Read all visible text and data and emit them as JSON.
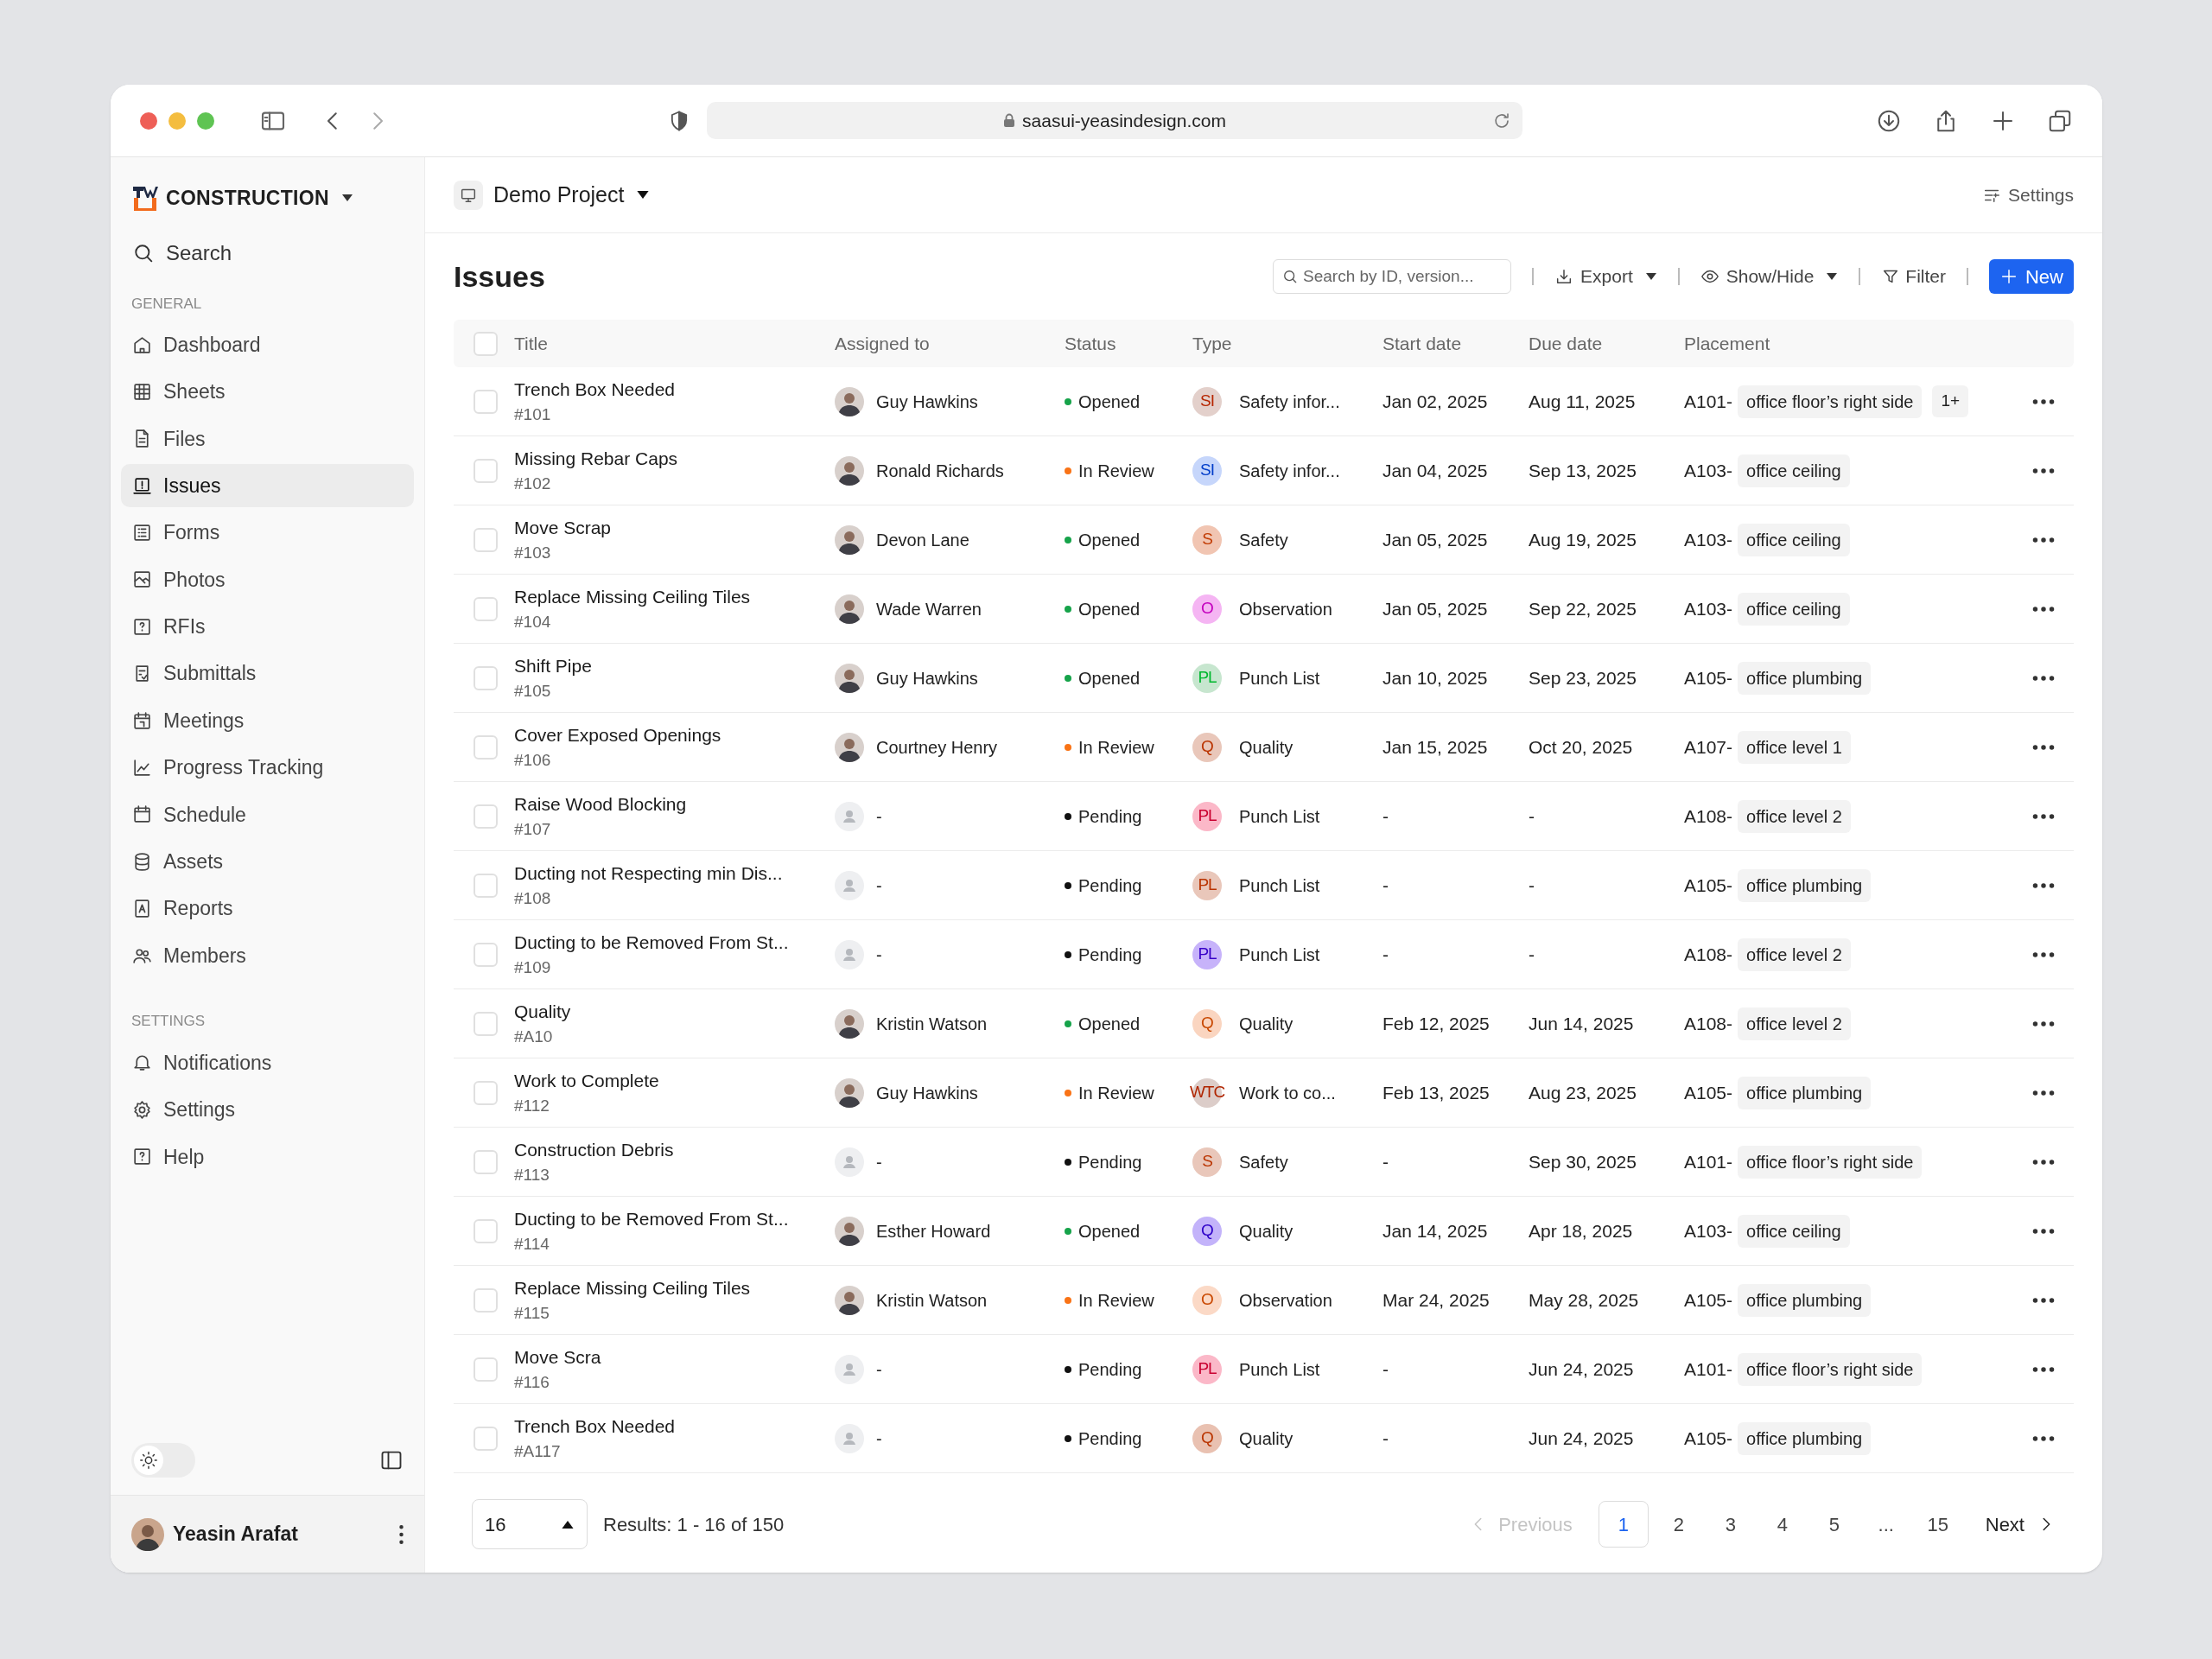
{
  "browser": {
    "url": "saasui-yeasindesign.com"
  },
  "sidebar": {
    "brand": "CONSTRUCTION",
    "search": "Search",
    "sections": [
      {
        "heading": "GENERAL",
        "items": [
          {
            "label": "Dashboard",
            "selected": false
          },
          {
            "label": "Sheets",
            "selected": false
          },
          {
            "label": "Files",
            "selected": false
          },
          {
            "label": "Issues",
            "selected": true
          },
          {
            "label": "Forms",
            "selected": false
          },
          {
            "label": "Photos",
            "selected": false
          },
          {
            "label": "RFIs",
            "selected": false
          },
          {
            "label": "Submittals",
            "selected": false
          },
          {
            "label": "Meetings",
            "selected": false
          },
          {
            "label": "Progress Tracking",
            "selected": false
          },
          {
            "label": "Schedule",
            "selected": false
          },
          {
            "label": "Assets",
            "selected": false
          },
          {
            "label": "Reports",
            "selected": false
          },
          {
            "label": "Members",
            "selected": false
          }
        ]
      },
      {
        "heading": "SETTINGS",
        "items": [
          {
            "label": "Notifications",
            "selected": false
          },
          {
            "label": "Settings",
            "selected": false
          },
          {
            "label": "Help",
            "selected": false
          }
        ]
      }
    ],
    "theme_toggle": {
      "on": false
    },
    "user": {
      "name": "Yeasin Arafat"
    }
  },
  "project": {
    "name": "Demo Project",
    "settings": "Settings"
  },
  "page": {
    "title": "Issues",
    "search": {
      "placeholder": "Search by ID, version..."
    },
    "export": "Export",
    "show_hide": "Show/Hide",
    "filter": "Filter",
    "new": "New"
  },
  "table": {
    "header_checked": false,
    "columns": [
      "Title",
      "Assigned to",
      "Status",
      "Type",
      "Start date",
      "Due date",
      "Placement"
    ],
    "rows": [
      {
        "checked": false,
        "title": "Trench Box Needed",
        "id": "#101",
        "assignee": {
          "kind": "person",
          "name": "Guy Hawkins"
        },
        "status": {
          "label": "Opened",
          "color": "#16a34a"
        },
        "type": {
          "initials": "SI",
          "label": "Safety infor...",
          "color": "#e3d0cb"
        },
        "start": "Jan 02, 2025",
        "due": "Aug 11, 2025",
        "placement": {
          "code": "A101-",
          "tag": "office floor’s right side",
          "more": "1+"
        }
      },
      {
        "checked": false,
        "title": "Missing Rebar Caps",
        "id": "#102",
        "assignee": {
          "kind": "person",
          "name": "Ronald Richards"
        },
        "status": {
          "label": "In Review",
          "color": "#f97316"
        },
        "type": {
          "initials": "SI",
          "label": "Safety infor...",
          "color": "#c6d6fb"
        },
        "start": "Jan 04, 2025",
        "due": "Sep 13, 2025",
        "placement": {
          "code": "A103-",
          "tag": "office ceiling"
        }
      },
      {
        "checked": false,
        "title": "Move Scrap",
        "id": "#103",
        "assignee": {
          "kind": "person",
          "name": "Devon Lane"
        },
        "status": {
          "label": "Opened",
          "color": "#16a34a"
        },
        "type": {
          "initials": "S",
          "label": "Safety",
          "color": "#f1c5b2"
        },
        "start": "Jan 05, 2025",
        "due": "Aug 19, 2025",
        "placement": {
          "code": "A103-",
          "tag": "office ceiling"
        }
      },
      {
        "checked": false,
        "title": "Replace Missing Ceiling Tiles",
        "id": "#104",
        "assignee": {
          "kind": "person",
          "name": "Wade Warren"
        },
        "status": {
          "label": "Opened",
          "color": "#16a34a"
        },
        "type": {
          "initials": "O",
          "label": "Observation",
          "color": "#f5b5f3"
        },
        "start": "Jan 05, 2025",
        "due": "Sep 22, 2025",
        "placement": {
          "code": "A103-",
          "tag": "office ceiling"
        }
      },
      {
        "checked": false,
        "title": "Shift Pipe",
        "id": "#105",
        "assignee": {
          "kind": "person",
          "name": "Guy Hawkins"
        },
        "status": {
          "label": "Opened",
          "color": "#16a34a"
        },
        "type": {
          "initials": "PL",
          "label": "Punch List",
          "color": "#c7e6cf"
        },
        "start": "Jan 10, 2025",
        "due": "Sep 23, 2025",
        "placement": {
          "code": "A105-",
          "tag": "office plumbing"
        }
      },
      {
        "checked": false,
        "title": "Cover Exposed Openings",
        "id": "#106",
        "assignee": {
          "kind": "person",
          "name": "Courtney Henry"
        },
        "status": {
          "label": "In Review",
          "color": "#f97316"
        },
        "type": {
          "initials": "Q",
          "label": "Quality",
          "color": "#e9c7ba"
        },
        "start": "Jan 15, 2025",
        "due": "Oct 20, 2025",
        "placement": {
          "code": "A107-",
          "tag": "office level 1"
        }
      },
      {
        "checked": false,
        "title": "Raise Wood Blocking",
        "id": "#107",
        "assignee": {
          "kind": "placeholder",
          "name": "-"
        },
        "status": {
          "label": "Pending",
          "color": "#111111"
        },
        "type": {
          "initials": "PL",
          "label": "Punch List",
          "color": "#fbb8c8"
        },
        "start": "-",
        "due": "-",
        "placement": {
          "code": "A108-",
          "tag": "office level 2"
        }
      },
      {
        "checked": false,
        "title": "Ducting not Respecting min Dis...",
        "id": "#108",
        "assignee": {
          "kind": "placeholder",
          "name": "-"
        },
        "status": {
          "label": "Pending",
          "color": "#111111"
        },
        "type": {
          "initials": "PL",
          "label": "Punch List",
          "color": "#e9c7ba"
        },
        "start": "-",
        "due": "-",
        "placement": {
          "code": "A105-",
          "tag": "office plumbing"
        }
      },
      {
        "checked": false,
        "title": "Ducting to be Removed From St...",
        "id": "#109",
        "assignee": {
          "kind": "placeholder",
          "name": "-"
        },
        "status": {
          "label": "Pending",
          "color": "#111111"
        },
        "type": {
          "initials": "PL",
          "label": "Punch List",
          "color": "#c7b3fa"
        },
        "start": "-",
        "due": "-",
        "placement": {
          "code": "A108-",
          "tag": "office level 2"
        }
      },
      {
        "checked": false,
        "title": "Quality",
        "id": "#A10",
        "assignee": {
          "kind": "person",
          "name": "Kristin Watson"
        },
        "status": {
          "label": "Opened",
          "color": "#16a34a"
        },
        "type": {
          "initials": "Q",
          "label": "Quality",
          "color": "#fad5c0"
        },
        "start": "Feb 12, 2025",
        "due": "Jun 14, 2025",
        "placement": {
          "code": "A108-",
          "tag": "office level 2"
        }
      },
      {
        "checked": false,
        "title": "Work to Complete",
        "id": "#112",
        "assignee": {
          "kind": "person",
          "name": "Guy Hawkins"
        },
        "status": {
          "label": "In Review",
          "color": "#f97316"
        },
        "type": {
          "initials": "WTC",
          "label": "Work to co...",
          "color": "#dccdc9"
        },
        "start": "Feb 13, 2025",
        "due": "Aug 23, 2025",
        "placement": {
          "code": "A105-",
          "tag": "office plumbing"
        }
      },
      {
        "checked": false,
        "title": "Construction Debris",
        "id": "#113",
        "assignee": {
          "kind": "placeholder",
          "name": "-"
        },
        "status": {
          "label": "Pending",
          "color": "#111111"
        },
        "type": {
          "initials": "S",
          "label": "Safety",
          "color": "#e9c7ba"
        },
        "start": "-",
        "due": "Sep 30, 2025",
        "placement": {
          "code": "A101-",
          "tag": "office floor’s right side"
        }
      },
      {
        "checked": false,
        "title": "Ducting to be Removed From St...",
        "id": "#114",
        "assignee": {
          "kind": "person",
          "name": "Esther Howard"
        },
        "status": {
          "label": "Opened",
          "color": "#16a34a"
        },
        "type": {
          "initials": "Q",
          "label": "Quality",
          "color": "#c3b3fa"
        },
        "start": "Jan 14, 2025",
        "due": "Apr 18, 2025",
        "placement": {
          "code": "A103-",
          "tag": "office ceiling"
        }
      },
      {
        "checked": false,
        "title": "Replace Missing Ceiling Tiles",
        "id": "#115",
        "assignee": {
          "kind": "person",
          "name": "Kristin Watson"
        },
        "status": {
          "label": "In Review",
          "color": "#f97316"
        },
        "type": {
          "initials": "O",
          "label": "Observation",
          "color": "#fbd9c6"
        },
        "start": "Mar 24, 2025",
        "due": "May 28, 2025",
        "placement": {
          "code": "A105-",
          "tag": "office plumbing"
        }
      },
      {
        "checked": false,
        "title": "Move Scra",
        "id": "#116",
        "assignee": {
          "kind": "placeholder",
          "name": "-"
        },
        "status": {
          "label": "Pending",
          "color": "#111111"
        },
        "type": {
          "initials": "PL",
          "label": "Punch List",
          "color": "#fbb8c8"
        },
        "start": "-",
        "due": "Jun 24, 2025",
        "placement": {
          "code": "A101-",
          "tag": "office floor’s right side"
        }
      },
      {
        "checked": false,
        "title": "Trench Box Needed",
        "id": "#A117",
        "assignee": {
          "kind": "placeholder",
          "name": "-"
        },
        "status": {
          "label": "Pending",
          "color": "#111111"
        },
        "type": {
          "initials": "Q",
          "label": "Quality",
          "color": "#e9c1b1"
        },
        "start": "-",
        "due": "Jun 24, 2025",
        "placement": {
          "code": "A105-",
          "tag": "office plumbing"
        }
      }
    ]
  },
  "footer": {
    "page_size": "16",
    "results": "Results: 1 - 16 of 150",
    "previous": {
      "label": "Previous",
      "disabled": true
    },
    "pages": [
      {
        "label": "1",
        "selected": true
      },
      {
        "label": "2",
        "selected": false
      },
      {
        "label": "3",
        "selected": false
      },
      {
        "label": "4",
        "selected": false
      },
      {
        "label": "5",
        "selected": false
      },
      {
        "label": "...",
        "selected": false
      },
      {
        "label": "15",
        "selected": false
      }
    ],
    "next": {
      "label": "Next",
      "disabled": false
    }
  }
}
